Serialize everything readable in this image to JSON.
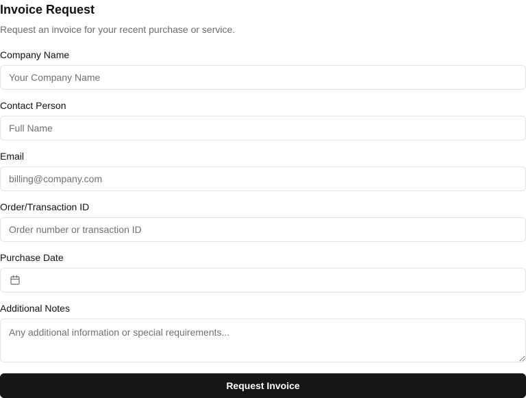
{
  "form": {
    "title": "Invoice Request",
    "subtitle": "Request an invoice for your recent purchase or service.",
    "company_name": {
      "label": "Company Name",
      "placeholder": "Your Company Name",
      "value": ""
    },
    "contact_person": {
      "label": "Contact Person",
      "placeholder": "Full Name",
      "value": ""
    },
    "email": {
      "label": "Email",
      "placeholder": "billing@company.com",
      "value": ""
    },
    "order_id": {
      "label": "Order/Transaction ID",
      "placeholder": "Order number or transaction ID",
      "value": ""
    },
    "purchase_date": {
      "label": "Purchase Date",
      "icon": "calendar-icon",
      "value": ""
    },
    "notes": {
      "label": "Additional Notes",
      "placeholder": "Any additional information or special requirements...",
      "value": ""
    },
    "submit_label": "Request Invoice"
  },
  "colors": {
    "primary_button": "#161616",
    "border": "#e2e2e2",
    "muted_text": "#6b6b6b"
  }
}
